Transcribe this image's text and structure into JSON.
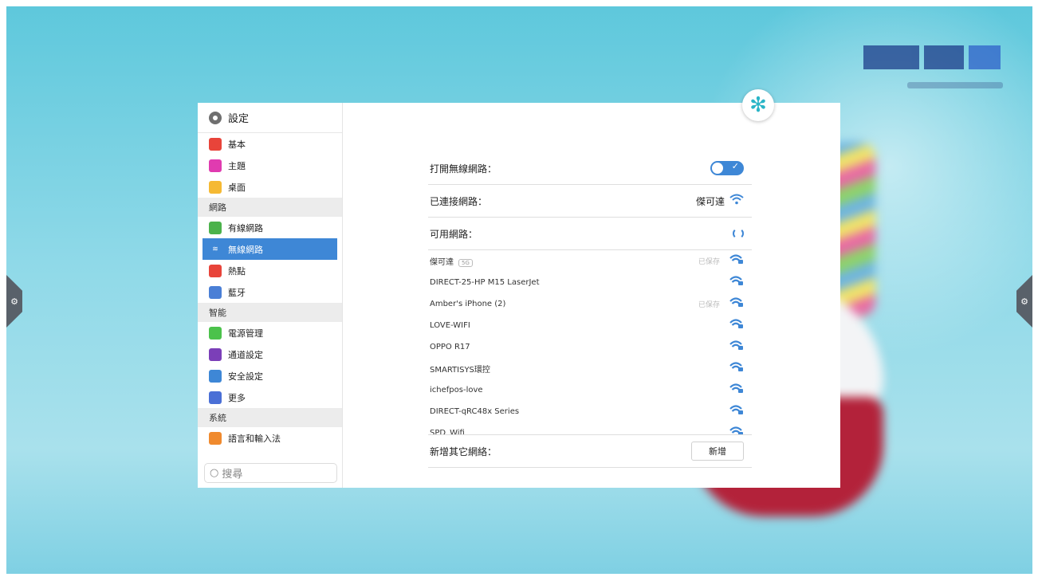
{
  "sidebar": {
    "title": "設定",
    "items": [
      {
        "label": "基本",
        "icon": "layers-icon",
        "color": "#e8443a",
        "type": "item"
      },
      {
        "label": "主題",
        "icon": "shirt-icon",
        "color": "#e03bb0",
        "type": "item"
      },
      {
        "label": "桌面",
        "icon": "picture-icon",
        "color": "#f5b933",
        "type": "item"
      },
      {
        "label": "網路",
        "type": "group"
      },
      {
        "label": "有線網路",
        "icon": "ethernet-icon",
        "color": "#4bb24b",
        "type": "item"
      },
      {
        "label": "無線網路",
        "icon": "wifi-icon",
        "color": "#3e87d6",
        "type": "item",
        "active": true
      },
      {
        "label": "熱點",
        "icon": "hotspot-icon",
        "color": "#e8443a",
        "type": "item"
      },
      {
        "label": "藍牙",
        "icon": "bluetooth-icon",
        "color": "#4a7fd6",
        "type": "item"
      },
      {
        "label": "智能",
        "type": "group"
      },
      {
        "label": "電源管理",
        "icon": "power-icon",
        "color": "#4bc24b",
        "type": "item"
      },
      {
        "label": "通道設定",
        "icon": "channel-icon",
        "color": "#7b3fb8",
        "type": "item"
      },
      {
        "label": "安全設定",
        "icon": "shield-icon",
        "color": "#3e87d6",
        "type": "item"
      },
      {
        "label": "更多",
        "icon": "more-icon",
        "color": "#4a6fd6",
        "type": "item"
      },
      {
        "label": "系統",
        "type": "group"
      },
      {
        "label": "語言和輸入法",
        "icon": "keyboard-icon",
        "color": "#f08a2e",
        "type": "item"
      }
    ],
    "search_placeholder": "搜尋"
  },
  "main": {
    "wifi_toggle_label": "打開無線網路：",
    "connected_label": "已連接網路：",
    "connected_value": "傑可達",
    "available_label": "可用網路：",
    "networks": [
      {
        "name": "傑可達",
        "tag": "5G",
        "status": "已保存"
      },
      {
        "name": "DIRECT-25-HP M15 LaserJet",
        "tag": "",
        "status": ""
      },
      {
        "name": "Amber's iPhone (2)",
        "tag": "",
        "status": "已保存"
      },
      {
        "name": "LOVE-WIFI",
        "tag": "",
        "status": ""
      },
      {
        "name": "OPPO R17",
        "tag": "",
        "status": ""
      },
      {
        "name": "SMARTISYS環控",
        "tag": "",
        "status": ""
      },
      {
        "name": "ichefpos-love",
        "tag": "",
        "status": ""
      },
      {
        "name": "DIRECT-qRC48x Series",
        "tag": "",
        "status": ""
      },
      {
        "name": "SPD_Wifi",
        "tag": "",
        "status": ""
      }
    ],
    "add_other_label": "新增其它網絡：",
    "add_button": "新增"
  },
  "colors": {
    "accent": "#3e87d6"
  }
}
